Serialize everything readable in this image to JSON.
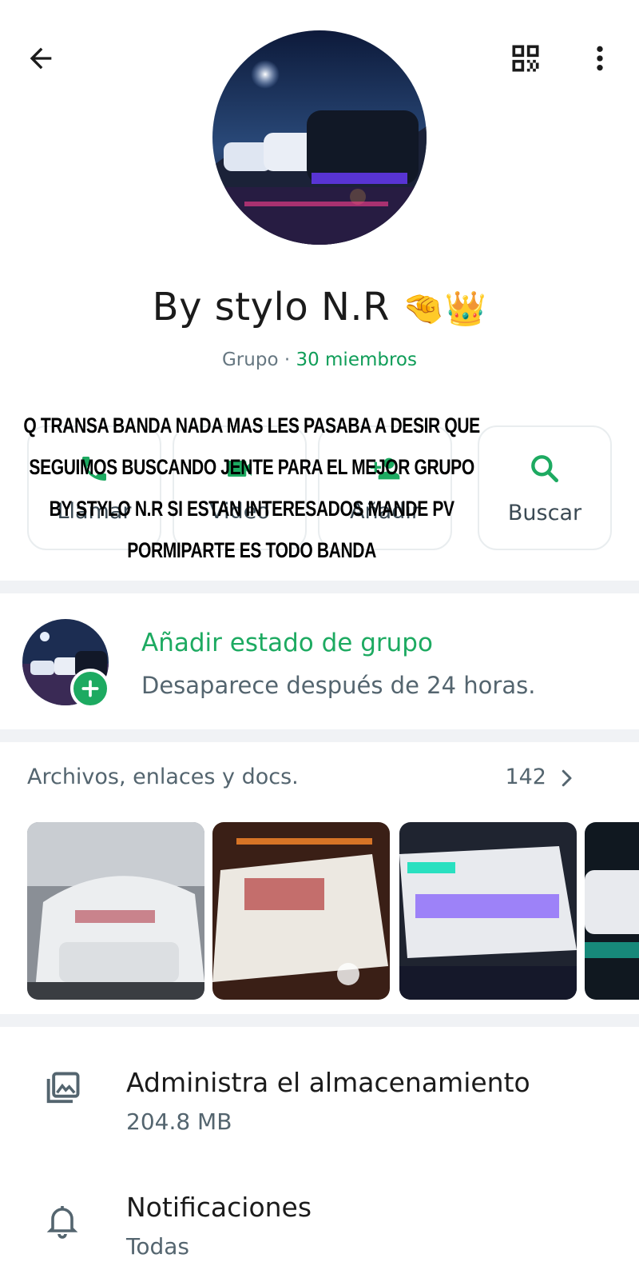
{
  "header": {
    "back_icon": "arrow-left-icon",
    "qr_icon": "qr-code-icon",
    "menu_icon": "more-vertical-icon"
  },
  "group": {
    "name": "By stylo N.R",
    "name_emoji": "🤏👑",
    "type_label": "Grupo",
    "separator": " · ",
    "members_label": "30 miembros"
  },
  "actions": [
    {
      "label": "Llamar",
      "icon": "phone-icon"
    },
    {
      "label": "Video",
      "icon": "video-icon"
    },
    {
      "label": "Añadir",
      "icon": "add-member-icon"
    },
    {
      "label": "Buscar",
      "icon": "search-icon"
    }
  ],
  "overlay_text": [
    "Q TRANSA BANDA NADA MAS LES PASABA A DESIR QUE",
    "SEGUIMOS BUSCANDO JENTE PARA EL MEJOR GRUPO",
    "BY STYLO N.R SI ESTAN INTERESADOS MANDE PV",
    "PORMIPARTE ES TODO BANDA"
  ],
  "status": {
    "title": "Añadir estado de grupo",
    "subtitle": "Desaparece después de 24 horas."
  },
  "media": {
    "title": "Archivos, enlaces y docs.",
    "count": "142"
  },
  "settings": [
    {
      "title": "Administra el almacenamiento",
      "subtitle": "204.8 MB",
      "icon": "storage-icon"
    },
    {
      "title": "Notificaciones",
      "subtitle": "Todas",
      "icon": "bell-icon"
    }
  ],
  "colors": {
    "accent_green": "#1daa61",
    "text_secondary": "#54656f",
    "divider": "#f0f2f5"
  }
}
